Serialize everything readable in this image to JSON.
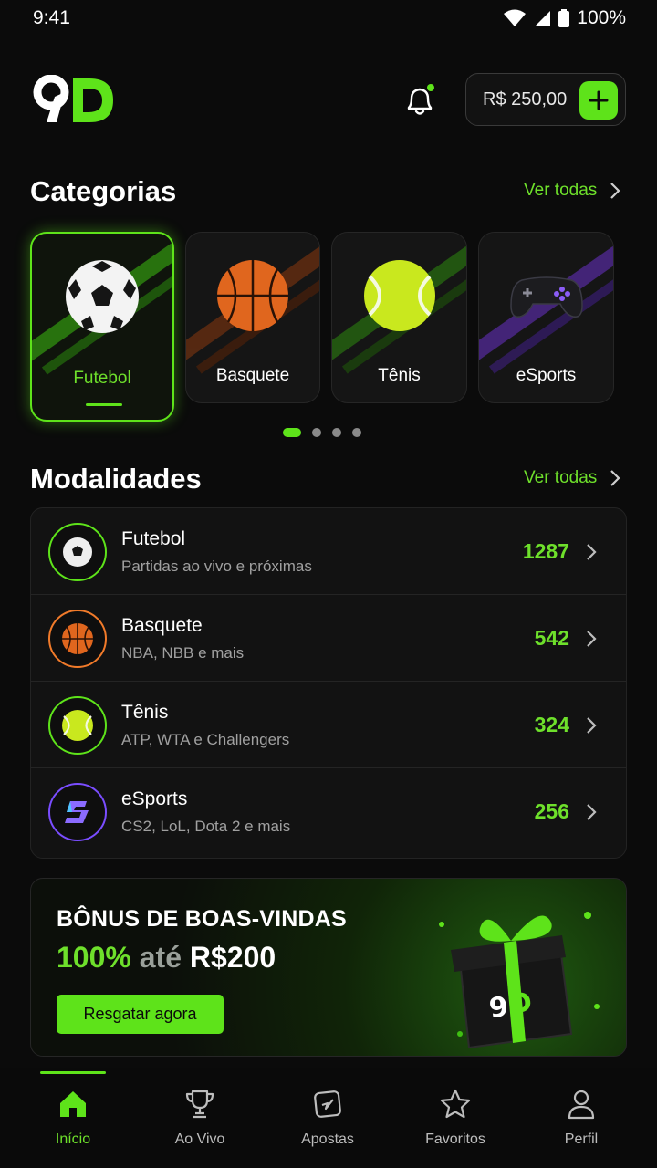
{
  "status": {
    "time": "9:41",
    "battery": "100%"
  },
  "header": {
    "balance": "R$ 250,00"
  },
  "categories": {
    "title": "Categorias",
    "see_all": "Ver todas",
    "items": [
      {
        "label": "Futebol",
        "icon": "soccer-ball-icon"
      },
      {
        "label": "Basquete",
        "icon": "basketball-icon"
      },
      {
        "label": "Tênis",
        "icon": "tennis-ball-icon"
      },
      {
        "label": "eSports",
        "icon": "gamepad-icon"
      }
    ],
    "page_count": 4,
    "active_page": 1
  },
  "modalities": {
    "title": "Modalidades",
    "see_all": "Ver todas",
    "items": [
      {
        "title": "Futebol",
        "subtitle": "Partidas ao vivo e próximas",
        "count": "1287"
      },
      {
        "title": "Basquete",
        "subtitle": "NBA, NBB e mais",
        "count": "542"
      },
      {
        "title": "Tênis",
        "subtitle": "ATP, WTA e Challengers",
        "count": "324"
      },
      {
        "title": "eSports",
        "subtitle": "CS2, LoL, Dota 2 e mais",
        "count": "256"
      }
    ]
  },
  "banner": {
    "title": "BÔNUS DE BOAS-VINDAS",
    "offer_percent": "100%",
    "offer_mid": "até",
    "offer_amount": "R$200",
    "button": "Resgatar agora"
  },
  "nav": {
    "items": [
      {
        "label": "Início",
        "icon": "home-icon"
      },
      {
        "label": "Ao Vivo",
        "icon": "trophy-icon"
      },
      {
        "label": "Apostas",
        "icon": "ticket-icon"
      },
      {
        "label": "Favoritos",
        "icon": "star-icon"
      },
      {
        "label": "Perfil",
        "icon": "user-icon"
      }
    ],
    "active": "Início"
  },
  "colors": {
    "accent": "#5ee31a",
    "background": "#0b0b0b",
    "card": "#121212",
    "orange": "#f07a2a",
    "purple": "#7a4dff"
  }
}
